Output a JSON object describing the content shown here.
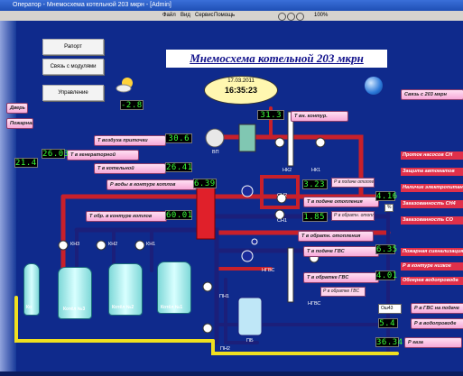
{
  "window": {
    "title": "Оператор - Мнемосхема котельной 203 мкрн - [Admin]"
  },
  "menu": {
    "items": [
      "Файл",
      "Вид",
      "Сервис",
      "Помощь"
    ],
    "zoom": "100%"
  },
  "buttons": {
    "report": "Рапорт",
    "modules": "Связь с модулями",
    "control": "Управление"
  },
  "main": {
    "title": "Мнемосхема котельной 203 мкрн",
    "date": "17.03.2011",
    "time": "16:35:23"
  },
  "readings": {
    "outdoor": "-2.8",
    "contour_temp": "31.3",
    "supply_air_temp": "30.6",
    "generator_temp": "26.03",
    "boiler_room_temp": "26.41",
    "generator2": "21.4",
    "boiler_contour_pressure": "6.39",
    "boiler_return_temp": "60.01",
    "heat_supply_pressure": "3.23",
    "heat_supply_temp": "4.16",
    "heat_return_pressure": "1.85",
    "hot_water_temp": "6.35",
    "hot_water_return": "4.01",
    "hot_water_pressure": "5.4",
    "gas_pressure": "36.34"
  },
  "labels": {
    "link_203": "Связь с 203 мкрн",
    "t_outdoor": "Т нар.",
    "t_contour": "Т вн. контур.",
    "t_supply_air": "Т воздуха приточки",
    "t_generator": "Т в генераторной",
    "t_boiler_room": "Т в котельной",
    "p_boiler_contour": "Р воды в контуре котлов",
    "t_boiler_return": "Т обр. в контуре котлов",
    "p_heat_supply": "Р в подаче отопления",
    "t_heat_supply": "Т в подаче отопления",
    "p_heat_return": "Р в обратн. отопления",
    "t_heat_return": "Т в обратн. отопления",
    "t_hws_supply": "Т в подаче ГВС",
    "t_hws_return": "Т в обратке ГВС",
    "p_hws_return": "Р в обратке ГВС",
    "p_hws_supply": "Р в ГВС на подаче",
    "p_water_main": "Р в водопроводе",
    "p_gas": "Р газа",
    "door": "Дверь",
    "fire": "Пожарная",
    "unit_pct": "%",
    "unit_a": "Ош43"
  },
  "alarms": [
    "Проток насосов СН",
    "Защита автоматов",
    "Наличие электропитания",
    "Загазованность СН4",
    "Загазованность СО",
    "Пожарная сигнализация",
    "Р в контуре низкое",
    "Обогрев водопровода"
  ],
  "equipment": {
    "boilers": [
      "Котёл №3",
      "Котёл №2",
      "Котёл №1"
    ],
    "boiler_pumps": [
      "КН3",
      "КН2",
      "КН1"
    ],
    "fan": "ВП",
    "network_pumps": [
      "НК2",
      "НК1"
    ],
    "heat_pumps": [
      "СН2",
      "СН1"
    ],
    "hws_pumps": [
      "НГВС",
      "НГВС"
    ],
    "makeup_pumps": [
      "ПН1",
      "ПН2"
    ],
    "tank": "ПБ",
    "boiler4": "Ко"
  },
  "colors": {
    "pipe_supply": "#c8202a",
    "pipe_return": "#1b1f7a",
    "pipe_yellow": "#f0e020",
    "background": "#0f2a8c"
  }
}
